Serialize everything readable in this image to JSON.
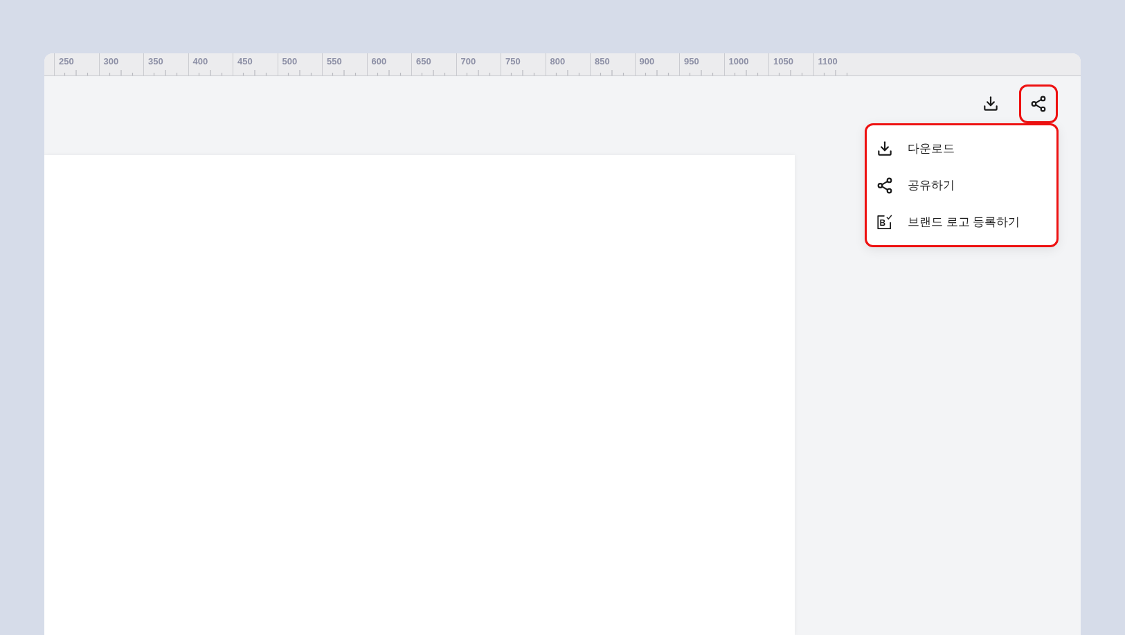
{
  "ruler": {
    "labels": [
      "250",
      "300",
      "350",
      "400",
      "450",
      "500",
      "550",
      "600",
      "650",
      "700",
      "750",
      "800",
      "850",
      "900",
      "950",
      "1000",
      "1050",
      "1100"
    ]
  },
  "toolbar": {
    "buttons": [
      {
        "kind": "download",
        "highlighted": false
      },
      {
        "kind": "share",
        "highlighted": true
      }
    ]
  },
  "menu": {
    "highlighted": true,
    "items": [
      {
        "kind": "download",
        "label": "다운로드"
      },
      {
        "kind": "share",
        "label": "공유하기"
      },
      {
        "kind": "brand-logo",
        "label": "브랜드 로고 등록하기",
        "icon_letter": "B"
      }
    ]
  }
}
